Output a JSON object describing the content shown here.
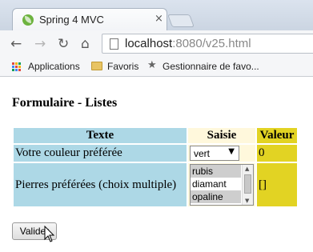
{
  "browser": {
    "tab_title": "Spring 4 MVC",
    "tab_close": "×",
    "url_host": "localhost",
    "url_rest": ":8080/v25.html",
    "icons": [
      "back-icon",
      "forward-icon",
      "reload-icon",
      "home-icon",
      "page-icon"
    ],
    "nav": {
      "back": "←",
      "forward": "→",
      "reload": "↻",
      "home": "⌂"
    }
  },
  "bookmarks": {
    "apps": "Applications",
    "favoris": "Favoris",
    "manager": "Gestionnaire de favo..."
  },
  "page": {
    "title": "Formulaire - Listes",
    "headers": {
      "texte": "Texte",
      "saisie": "Saisie",
      "valeur": "Valeur"
    },
    "rows": [
      {
        "label": "Votre couleur préférée",
        "selected": "vert",
        "value": "0"
      },
      {
        "label": "Pierres préférées (choix multiple)",
        "options": [
          "rubis",
          "diamant",
          "opaline"
        ],
        "value": "[]"
      }
    ],
    "submit": "Valider"
  },
  "colors": {
    "header_texte": "#add8e6",
    "header_saisie": "#fff8dc",
    "valeur": "#e2d323"
  }
}
